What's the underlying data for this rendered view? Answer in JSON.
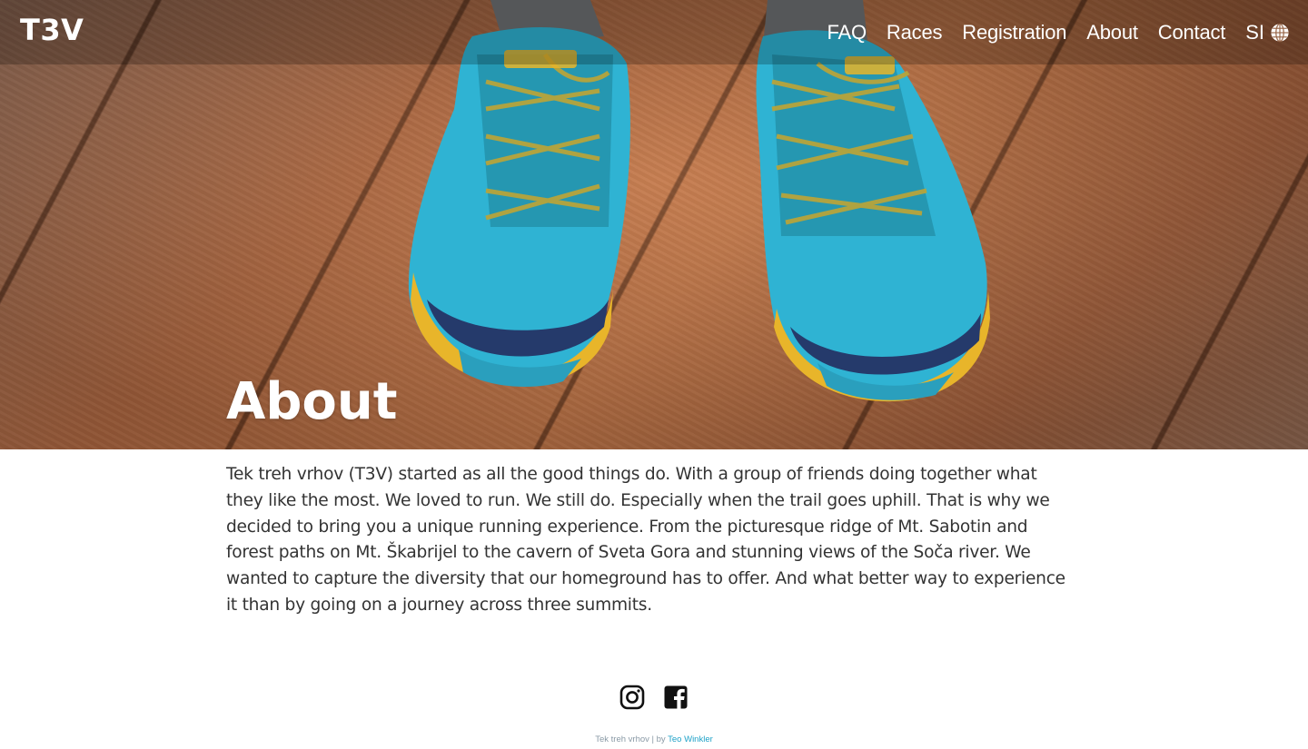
{
  "brand": {
    "logo": "T3V"
  },
  "nav": {
    "items": [
      {
        "label": "FAQ"
      },
      {
        "label": "Races"
      },
      {
        "label": "Registration"
      },
      {
        "label": "About"
      },
      {
        "label": "Contact"
      }
    ],
    "language": "SI"
  },
  "hero": {
    "title": "About"
  },
  "about": {
    "text": "Tek treh vrhov (T3V) started as all the good things do. With a group of friends doing together what they like the most. We loved to run. We still do. Especially when the trail goes uphill. That is why we decided to bring you a unique running experience. From the picturesque ridge of Mt. Sabotin and forest paths on Mt. Škabrijel to the cavern of Sveta Gora and stunning views of the Soča river. We wanted to capture the diversity that our homeground has to offer. And what better way to experience it than by going on a journey across three summits."
  },
  "footer": {
    "social": [
      "instagram-icon",
      "facebook-icon"
    ],
    "credit_site": "Tek treh vrhov",
    "credit_sep": " | by ",
    "credit_author": "Teo Winkler"
  },
  "colors": {
    "text": "#333333",
    "link_accent": "#20a2c8",
    "shoe_blue": "#2fb3d3",
    "shoe_yellow": "#e8b52a"
  }
}
